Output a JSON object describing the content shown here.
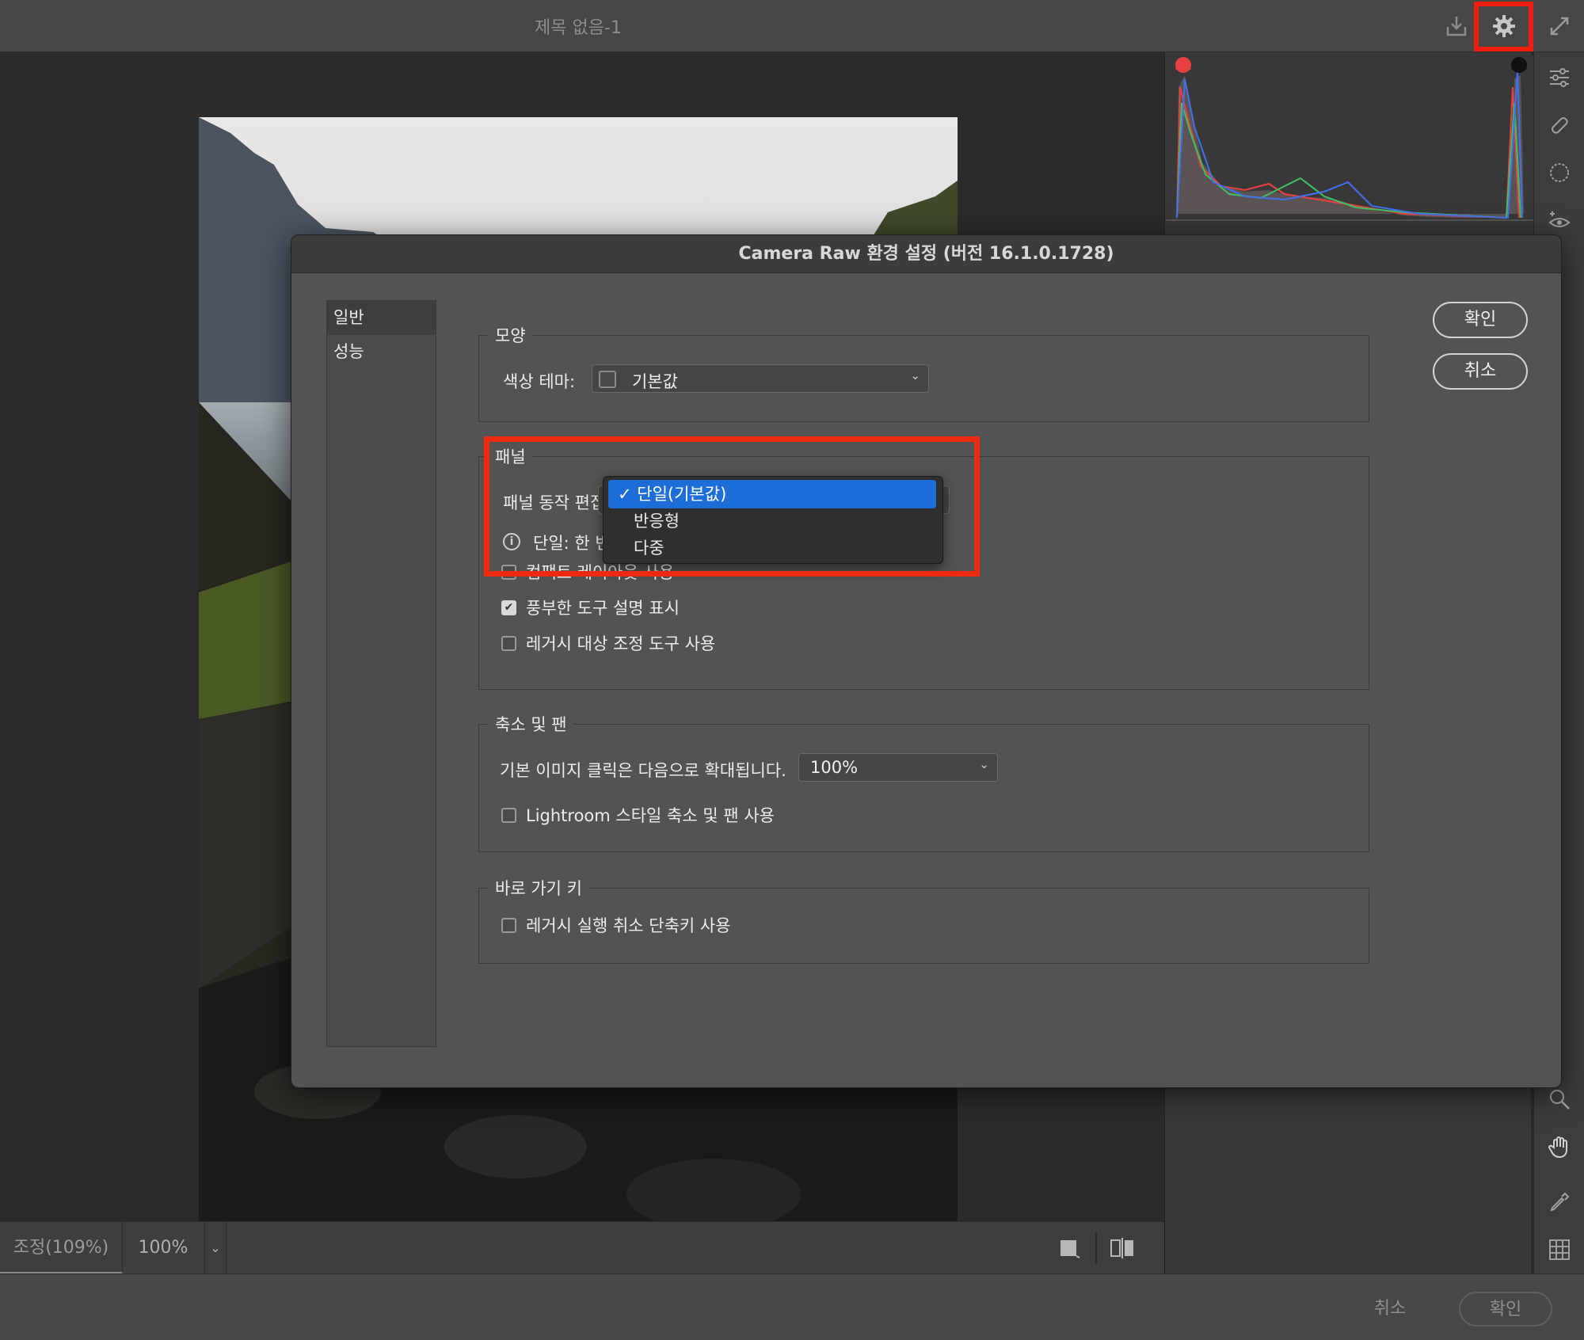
{
  "window": {
    "document_title": "제목 없음-1"
  },
  "bottom_bar": {
    "zoom_label": "조정(109%)",
    "zoom_value": "100%"
  },
  "footer": {
    "cancel_label": "취소",
    "ok_label": "확인"
  },
  "dialog": {
    "title": "Camera Raw 환경 설정  (버전 16.1.0.1728)",
    "sidebar": {
      "items": [
        "일반",
        "성능"
      ],
      "active_index": 0
    },
    "ok_label": "확인",
    "cancel_label": "취소",
    "appearance": {
      "legend": "모양",
      "color_theme_label": "색상 테마:",
      "color_theme_value": "기본값"
    },
    "panels": {
      "legend": "패널",
      "behavior_label": "패널 동작 편집",
      "info_text": "단일: 한 번",
      "checkboxes": [
        {
          "label": "컴팩트 레이아웃 사용",
          "checked": false
        },
        {
          "label": "풍부한 도구 설명 표시",
          "checked": true
        },
        {
          "label": "레거시 대상 조정 도구 사용",
          "checked": false
        }
      ],
      "dropdown_options": [
        "단일(기본값)",
        "반응형",
        "다중"
      ],
      "dropdown_selected_index": 0
    },
    "zoom_pan": {
      "legend": "축소 및 팬",
      "default_click_label": "기본 이미지 클릭은 다음으로 확대됩니다.",
      "default_click_value": "100%",
      "checkboxes": [
        {
          "label": "Lightroom 스타일 축소 및 팬 사용",
          "checked": false
        }
      ]
    },
    "shortcuts": {
      "legend": "바로 가기 키",
      "checkboxes": [
        {
          "label": "레거시 실행 취소 단축키 사용",
          "checked": false
        }
      ]
    }
  },
  "colors": {
    "highlight_red": "#ef2a10",
    "menu_selection_blue": "#1d6ed8"
  },
  "icons": {
    "top_bar": [
      "save-icon",
      "gear-icon",
      "fullscreen-icon"
    ],
    "tool_strip": [
      "sliders-icon",
      "healing-brush-icon",
      "mask-icon",
      "red-eye-icon",
      "zoom-icon",
      "hand-icon",
      "eyedropper-icon",
      "grid-icon"
    ]
  }
}
